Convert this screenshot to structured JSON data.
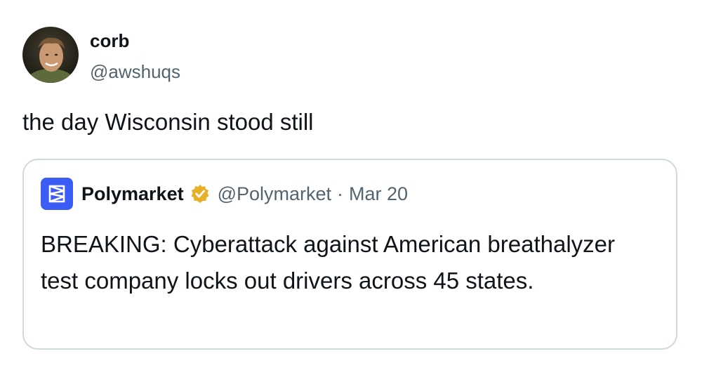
{
  "author": {
    "display_name": "corb",
    "handle": "@awshuqs"
  },
  "tweet_text": "the day Wisconsin stood still",
  "quoted_tweet": {
    "display_name": "Polymarket",
    "handle": "@Polymarket",
    "separator": "·",
    "date": "Mar 20",
    "text": "BREAKING: Cyberattack against American breathalyzer test company locks out drivers across 45 states.",
    "verified": true,
    "logo_icon": "polymarket-logo-icon",
    "badge_icon": "gold-verified-badge-icon"
  },
  "colors": {
    "primary_text": "#0f1419",
    "secondary_text": "#536471",
    "border": "#cfd9de",
    "polymarket_blue": "#3d5cf5",
    "verified_gold": "#e8b02a"
  }
}
